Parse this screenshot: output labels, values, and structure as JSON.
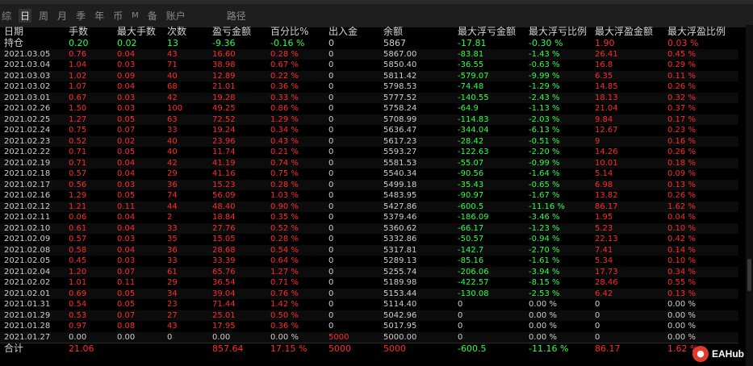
{
  "colors": {
    "positive": "#ff2a2a",
    "negative": "#2bff4a",
    "neutral": "#cfcfcf"
  },
  "tabs": [
    {
      "label": "综",
      "active": false
    },
    {
      "label": "日",
      "active": true
    },
    {
      "label": "周",
      "active": false
    },
    {
      "label": "月",
      "active": false
    },
    {
      "label": "季",
      "active": false
    },
    {
      "label": "年",
      "active": false
    },
    {
      "label": "币",
      "active": false
    },
    {
      "label": "M",
      "active": false
    },
    {
      "label": "备",
      "active": false
    },
    {
      "label": "账户",
      "active": false
    },
    {
      "label": "路径",
      "active": false
    }
  ],
  "table": {
    "headers": [
      "日期",
      "手数",
      "最大手数",
      "次数",
      "盈亏金额",
      "百分比%",
      "出入金",
      "余额",
      "最大浮亏金额",
      "最大浮亏比例",
      "最大浮盈金额",
      "最大浮盈比例"
    ],
    "holding": {
      "date": "持仓",
      "lots": "0.20",
      "max_lots": "0.02",
      "count": "13",
      "pnl": "-9.36",
      "pct": "-0.16 %",
      "io": "0",
      "balance": "5867",
      "max_float_loss": "-17.81",
      "max_float_loss_pct": "-0.30 %",
      "max_float_profit": "1.90",
      "max_float_profit_pct": "0.03 %"
    },
    "rows": [
      {
        "date": "2021.03.05",
        "lots": "0.76",
        "max_lots": "0.04",
        "count": "43",
        "pnl": "16.60",
        "pct": "0.28 %",
        "io": "0",
        "balance": "5867.00",
        "max_float_loss": "-83.81",
        "max_float_loss_pct": "-1.43 %",
        "max_float_profit": "26.41",
        "max_float_profit_pct": "0.45 %"
      },
      {
        "date": "2021.03.04",
        "lots": "1.04",
        "max_lots": "0.03",
        "count": "71",
        "pnl": "38.98",
        "pct": "0.67 %",
        "io": "0",
        "balance": "5850.40",
        "max_float_loss": "-36.55",
        "max_float_loss_pct": "-0.63 %",
        "max_float_profit": "16.8",
        "max_float_profit_pct": "0.29 %"
      },
      {
        "date": "2021.03.03",
        "lots": "1.02",
        "max_lots": "0.09",
        "count": "40",
        "pnl": "12.89",
        "pct": "0.22 %",
        "io": "0",
        "balance": "5811.42",
        "max_float_loss": "-579.07",
        "max_float_loss_pct": "-9.99 %",
        "max_float_profit": "6.35",
        "max_float_profit_pct": "0.11 %"
      },
      {
        "date": "2021.03.02",
        "lots": "1.07",
        "max_lots": "0.04",
        "count": "68",
        "pnl": "21.01",
        "pct": "0.36 %",
        "io": "0",
        "balance": "5798.53",
        "max_float_loss": "-74.48",
        "max_float_loss_pct": "-1.29 %",
        "max_float_profit": "14.85",
        "max_float_profit_pct": "0.26 %"
      },
      {
        "date": "2021.03.01",
        "lots": "0.67",
        "max_lots": "0.03",
        "count": "42",
        "pnl": "19.28",
        "pct": "0.33 %",
        "io": "0",
        "balance": "5777.52",
        "max_float_loss": "-140.55",
        "max_float_loss_pct": "-2.43 %",
        "max_float_profit": "18.13",
        "max_float_profit_pct": "0.32 %"
      },
      {
        "date": "2021.02.26",
        "lots": "1.50",
        "max_lots": "0.03",
        "count": "100",
        "pnl": "49.25",
        "pct": "0.86 %",
        "io": "0",
        "balance": "5758.24",
        "max_float_loss": "-64.9",
        "max_float_loss_pct": "-1.13 %",
        "max_float_profit": "21.04",
        "max_float_profit_pct": "0.37 %"
      },
      {
        "date": "2021.02.25",
        "lots": "1.27",
        "max_lots": "0.05",
        "count": "63",
        "pnl": "72.52",
        "pct": "1.29 %",
        "io": "0",
        "balance": "5708.99",
        "max_float_loss": "-114.83",
        "max_float_loss_pct": "-2.03 %",
        "max_float_profit": "9.84",
        "max_float_profit_pct": "0.17 %"
      },
      {
        "date": "2021.02.24",
        "lots": "0.75",
        "max_lots": "0.07",
        "count": "33",
        "pnl": "19.24",
        "pct": "0.34 %",
        "io": "0",
        "balance": "5636.47",
        "max_float_loss": "-344.04",
        "max_float_loss_pct": "-6.13 %",
        "max_float_profit": "12.67",
        "max_float_profit_pct": "0.23 %"
      },
      {
        "date": "2021.02.23",
        "lots": "0.52",
        "max_lots": "0.02",
        "count": "40",
        "pnl": "23.96",
        "pct": "0.43 %",
        "io": "0",
        "balance": "5617.23",
        "max_float_loss": "-28.42",
        "max_float_loss_pct": "-0.51 %",
        "max_float_profit": "9",
        "max_float_profit_pct": "0.16 %"
      },
      {
        "date": "2021.02.22",
        "lots": "0.71",
        "max_lots": "0.05",
        "count": "40",
        "pnl": "11.74",
        "pct": "0.21 %",
        "io": "0",
        "balance": "5593.27",
        "max_float_loss": "-122.63",
        "max_float_loss_pct": "-2.20 %",
        "max_float_profit": "14.26",
        "max_float_profit_pct": "0.26 %"
      },
      {
        "date": "2021.02.19",
        "lots": "0.71",
        "max_lots": "0.04",
        "count": "42",
        "pnl": "41.19",
        "pct": "0.74 %",
        "io": "0",
        "balance": "5581.53",
        "max_float_loss": "-55.07",
        "max_float_loss_pct": "-0.99 %",
        "max_float_profit": "10.01",
        "max_float_profit_pct": "0.18 %"
      },
      {
        "date": "2021.02.18",
        "lots": "0.57",
        "max_lots": "0.04",
        "count": "29",
        "pnl": "41.16",
        "pct": "0.75 %",
        "io": "0",
        "balance": "5540.34",
        "max_float_loss": "-90.56",
        "max_float_loss_pct": "-1.64 %",
        "max_float_profit": "5.14",
        "max_float_profit_pct": "0.09 %"
      },
      {
        "date": "2021.02.17",
        "lots": "0.56",
        "max_lots": "0.03",
        "count": "36",
        "pnl": "15.23",
        "pct": "0.28 %",
        "io": "0",
        "balance": "5499.18",
        "max_float_loss": "-35.43",
        "max_float_loss_pct": "-0.65 %",
        "max_float_profit": "6.98",
        "max_float_profit_pct": "0.13 %"
      },
      {
        "date": "2021.02.16",
        "lots": "1.29",
        "max_lots": "0.05",
        "count": "74",
        "pnl": "56.09",
        "pct": "1.03 %",
        "io": "0",
        "balance": "5483.95",
        "max_float_loss": "-90.97",
        "max_float_loss_pct": "-1.67 %",
        "max_float_profit": "13.82",
        "max_float_profit_pct": "0.26 %"
      },
      {
        "date": "2021.02.12",
        "lots": "1.21",
        "max_lots": "0.11",
        "count": "44",
        "pnl": "48.40",
        "pct": "0.90 %",
        "io": "0",
        "balance": "5427.86",
        "max_float_loss": "-600.5",
        "max_float_loss_pct": "-11.16 %",
        "max_float_profit": "86.17",
        "max_float_profit_pct": "1.62 %"
      },
      {
        "date": "2021.02.11",
        "lots": "0.06",
        "max_lots": "0.04",
        "count": "2",
        "pnl": "18.84",
        "pct": "0.35 %",
        "io": "0",
        "balance": "5379.46",
        "max_float_loss": "-186.09",
        "max_float_loss_pct": "-3.46 %",
        "max_float_profit": "1.95",
        "max_float_profit_pct": "0.04 %"
      },
      {
        "date": "2021.02.10",
        "lots": "0.61",
        "max_lots": "0.04",
        "count": "33",
        "pnl": "27.76",
        "pct": "0.52 %",
        "io": "0",
        "balance": "5360.62",
        "max_float_loss": "-66.17",
        "max_float_loss_pct": "-1.23 %",
        "max_float_profit": "5.23",
        "max_float_profit_pct": "0.10 %"
      },
      {
        "date": "2021.02.09",
        "lots": "0.57",
        "max_lots": "0.03",
        "count": "35",
        "pnl": "15.05",
        "pct": "0.28 %",
        "io": "0",
        "balance": "5332.86",
        "max_float_loss": "-50.57",
        "max_float_loss_pct": "-0.94 %",
        "max_float_profit": "22.13",
        "max_float_profit_pct": "0.42 %"
      },
      {
        "date": "2021.02.08",
        "lots": "0.58",
        "max_lots": "0.04",
        "count": "36",
        "pnl": "28.68",
        "pct": "0.54 %",
        "io": "0",
        "balance": "5317.81",
        "max_float_loss": "-142.7",
        "max_float_loss_pct": "-2.70 %",
        "max_float_profit": "7.41",
        "max_float_profit_pct": "0.14 %"
      },
      {
        "date": "2021.02.05",
        "lots": "0.45",
        "max_lots": "0.03",
        "count": "33",
        "pnl": "33.39",
        "pct": "0.64 %",
        "io": "0",
        "balance": "5289.13",
        "max_float_loss": "-85.16",
        "max_float_loss_pct": "-1.61 %",
        "max_float_profit": "5.34",
        "max_float_profit_pct": "0.10 %"
      },
      {
        "date": "2021.02.04",
        "lots": "1.20",
        "max_lots": "0.07",
        "count": "61",
        "pnl": "65.76",
        "pct": "1.27 %",
        "io": "0",
        "balance": "5255.74",
        "max_float_loss": "-206.06",
        "max_float_loss_pct": "-3.94 %",
        "max_float_profit": "17.73",
        "max_float_profit_pct": "0.34 %"
      },
      {
        "date": "2021.02.02",
        "lots": "1.01",
        "max_lots": "0.11",
        "count": "29",
        "pnl": "36.54",
        "pct": "0.71 %",
        "io": "0",
        "balance": "5189.98",
        "max_float_loss": "-422.57",
        "max_float_loss_pct": "-8.15 %",
        "max_float_profit": "28.46",
        "max_float_profit_pct": "0.55 %"
      },
      {
        "date": "2021.02.01",
        "lots": "0.69",
        "max_lots": "0.05",
        "count": "34",
        "pnl": "39.04",
        "pct": "0.76 %",
        "io": "0",
        "balance": "5153.44",
        "max_float_loss": "-130.08",
        "max_float_loss_pct": "-2.53 %",
        "max_float_profit": "6.42",
        "max_float_profit_pct": "0.13 %"
      },
      {
        "date": "2021.01.31",
        "lots": "0.54",
        "max_lots": "0.05",
        "count": "23",
        "pnl": "71.44",
        "pct": "1.42 %",
        "io": "0",
        "balance": "5114.40",
        "max_float_loss": "0",
        "max_float_loss_pct": "0.00 %",
        "max_float_profit": "0",
        "max_float_profit_pct": "0.00 %"
      },
      {
        "date": "2021.01.29",
        "lots": "0.53",
        "max_lots": "0.07",
        "count": "27",
        "pnl": "25.01",
        "pct": "0.50 %",
        "io": "0",
        "balance": "5042.96",
        "max_float_loss": "0",
        "max_float_loss_pct": "0.00 %",
        "max_float_profit": "0",
        "max_float_profit_pct": "0.00 %"
      },
      {
        "date": "2021.01.28",
        "lots": "0.97",
        "max_lots": "0.08",
        "count": "43",
        "pnl": "17.95",
        "pct": "0.36 %",
        "io": "0",
        "balance": "5017.95",
        "max_float_loss": "0",
        "max_float_loss_pct": "0.00 %",
        "max_float_profit": "0",
        "max_float_profit_pct": "0.00 %"
      },
      {
        "date": "2021.01.27",
        "lots": "0.00",
        "max_lots": "0.00",
        "count": "0",
        "pnl": "0.00",
        "pct": "0.00 %",
        "io": "5000",
        "balance": "5000.00",
        "max_float_loss": "0",
        "max_float_loss_pct": "0.00 %",
        "max_float_profit": "0",
        "max_float_profit_pct": "0.00 %"
      }
    ],
    "total": {
      "date": "合计",
      "lots": "21.06",
      "max_lots": "",
      "count": "",
      "pnl": "857.64",
      "pct": "17.15 %",
      "io": "5000",
      "balance": "5000",
      "max_float_loss": "-600.5",
      "max_float_loss_pct": "-11.16 %",
      "max_float_profit": "86.17",
      "max_float_profit_pct": "1.62 %"
    }
  },
  "logo": {
    "text": "EAHub"
  }
}
